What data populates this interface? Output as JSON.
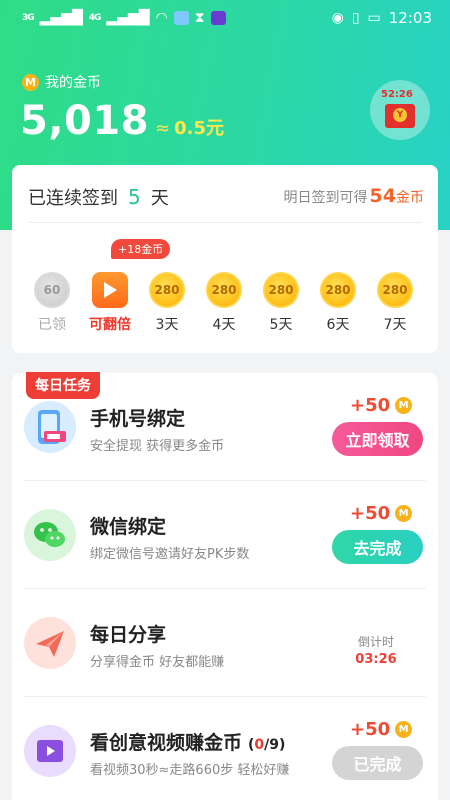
{
  "status_bar": {
    "time": "12:03",
    "sig1": "3G",
    "sig2": "4G"
  },
  "header": {
    "mycoins_label": "我的金币",
    "coin_glyph": "M",
    "balance": "5,018",
    "approx": "≈",
    "yuan": "0.5元",
    "redpacket_timer": "52:26",
    "redpacket_glyph": "Y"
  },
  "signin": {
    "prefix": "已连续签到",
    "days": "5",
    "suffix": "天",
    "tomorrow_prefix": "明日签到可得",
    "tomorrow_amount": "54",
    "tomorrow_unit": "金币",
    "bonus_tag": "+18金币",
    "days_list": [
      {
        "value": "60",
        "label": "已领",
        "state": "done"
      },
      {
        "value": "",
        "label": "可翻倍",
        "state": "play"
      },
      {
        "value": "280",
        "label": "3天",
        "state": "normal"
      },
      {
        "value": "280",
        "label": "4天",
        "state": "normal"
      },
      {
        "value": "280",
        "label": "5天",
        "state": "normal"
      },
      {
        "value": "280",
        "label": "6天",
        "state": "normal"
      },
      {
        "value": "280",
        "label": "7天",
        "state": "normal"
      }
    ]
  },
  "tasks": {
    "badge": "每日任务",
    "items": [
      {
        "title": "手机号绑定",
        "subtitle": "安全提现 获得更多金币",
        "reward": "+50",
        "button": "立即领取"
      },
      {
        "title": "微信绑定",
        "subtitle": "绑定微信号邀请好友PK步数",
        "reward": "+50",
        "button": "去完成"
      },
      {
        "title": "每日分享",
        "subtitle": "分享得金币 好友都能赚",
        "countdown_label": "倒计时",
        "countdown": "03:26"
      },
      {
        "title": "看创意视频赚金币",
        "count_open": "(",
        "count_done": "0",
        "count_total": "/9)",
        "subtitle": "看视频30秒≈走路660步 轻松好赚",
        "reward": "+50",
        "button": "已完成"
      }
    ]
  },
  "colors": {
    "accent_green": "#2bd8a4",
    "reward_red": "#f04b35",
    "gold": "#f8b31a"
  }
}
